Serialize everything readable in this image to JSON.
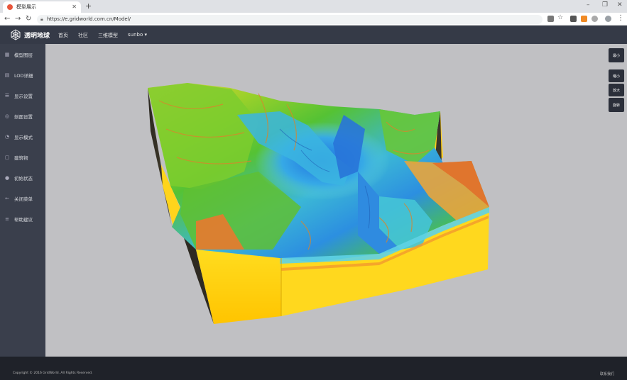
{
  "browser": {
    "tab_title": "模型展示",
    "url": "https://e.gridworld.com.cn/Model/",
    "colors": {
      "tabbar": "#dfe1e5"
    }
  },
  "header": {
    "logo_text": "透明地球",
    "menu": [
      {
        "label": "首页"
      },
      {
        "label": "社区"
      },
      {
        "label": "三维模型"
      },
      {
        "label": "sunbo ▾"
      }
    ]
  },
  "sidebar": {
    "items": [
      {
        "label": "模型图层",
        "icon": "grid-icon"
      },
      {
        "label": "LOD详细",
        "icon": "layers-icon"
      },
      {
        "label": "显示设置",
        "icon": "settings-icon"
      },
      {
        "label": "剖面设置",
        "icon": "slice-icon"
      },
      {
        "label": "显示模式",
        "icon": "eye-icon"
      },
      {
        "label": "建筑物",
        "icon": "building-icon"
      },
      {
        "label": "初始状态",
        "icon": "reset-icon"
      },
      {
        "label": "关闭菜单",
        "icon": "arrow-left-icon"
      },
      {
        "label": "帮助建议",
        "icon": "list-icon"
      }
    ]
  },
  "right_toolbar": {
    "buttons": [
      {
        "label": "最小"
      },
      {
        "label": "缩小"
      },
      {
        "label": "放大"
      },
      {
        "label": "旋转"
      }
    ]
  },
  "footer": {
    "copyright": "Copyright © 2016 GridWorld. All Rights Reserved.",
    "contact": "联系我们"
  },
  "theme": {
    "header_bg": "#353a47",
    "sidebar_bg": "#3a3f4c",
    "viewport_bg": "#c0c0c3",
    "footer_bg": "#1f2229",
    "model_side": "#ffd51a"
  }
}
